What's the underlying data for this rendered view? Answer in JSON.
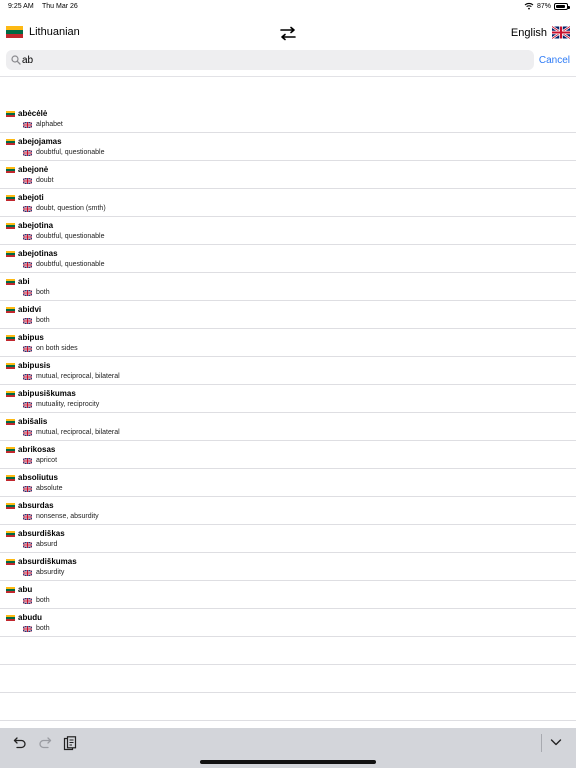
{
  "status": {
    "time": "9:25 AM",
    "date": "Thu Mar 26",
    "battery": "87%",
    "battery_level": 0.87
  },
  "languages": {
    "source": "Lithuanian",
    "target": "English"
  },
  "search": {
    "value": "ab",
    "placeholder": "",
    "cancel": "Cancel"
  },
  "entries": [
    {
      "term": "abėcėlė",
      "translation": "alphabet"
    },
    {
      "term": "abejojamas",
      "translation": "doubtful, questionable"
    },
    {
      "term": "abejonė",
      "translation": "doubt"
    },
    {
      "term": "abejoti",
      "translation": "doubt, question (smth)"
    },
    {
      "term": "abejotina",
      "translation": "doubtful, questionable"
    },
    {
      "term": "abejotinas",
      "translation": "doubtful, questionable"
    },
    {
      "term": "abi",
      "translation": "both"
    },
    {
      "term": "abidvi",
      "translation": "both"
    },
    {
      "term": "abipus",
      "translation": "on both sides"
    },
    {
      "term": "abipusis",
      "translation": "mutual, reciprocal, bilateral"
    },
    {
      "term": "abipusiškumas",
      "translation": "mutuality, reciprocity"
    },
    {
      "term": "abišalis",
      "translation": "mutual, reciprocal, bilateral"
    },
    {
      "term": "abrikosas",
      "translation": "apricot"
    },
    {
      "term": "absoliutus",
      "translation": "absolute"
    },
    {
      "term": "absurdas",
      "translation": "nonsense, absurdity"
    },
    {
      "term": "absurdiškas",
      "translation": "absurd"
    },
    {
      "term": "absurdiškumas",
      "translation": "absurdity"
    },
    {
      "term": "abu",
      "translation": "both"
    },
    {
      "term": "abudu",
      "translation": "both"
    }
  ],
  "icons": {
    "swap": "swap-arrows-icon",
    "search": "magnifier-icon",
    "undo": "undo-icon",
    "redo": "redo-icon",
    "paste": "clipboard-icon",
    "dismiss": "chevron-down-icon"
  },
  "colors": {
    "accent": "#2f7cf6",
    "toolbar": "#d3d5da",
    "separator": "#dedee2"
  }
}
